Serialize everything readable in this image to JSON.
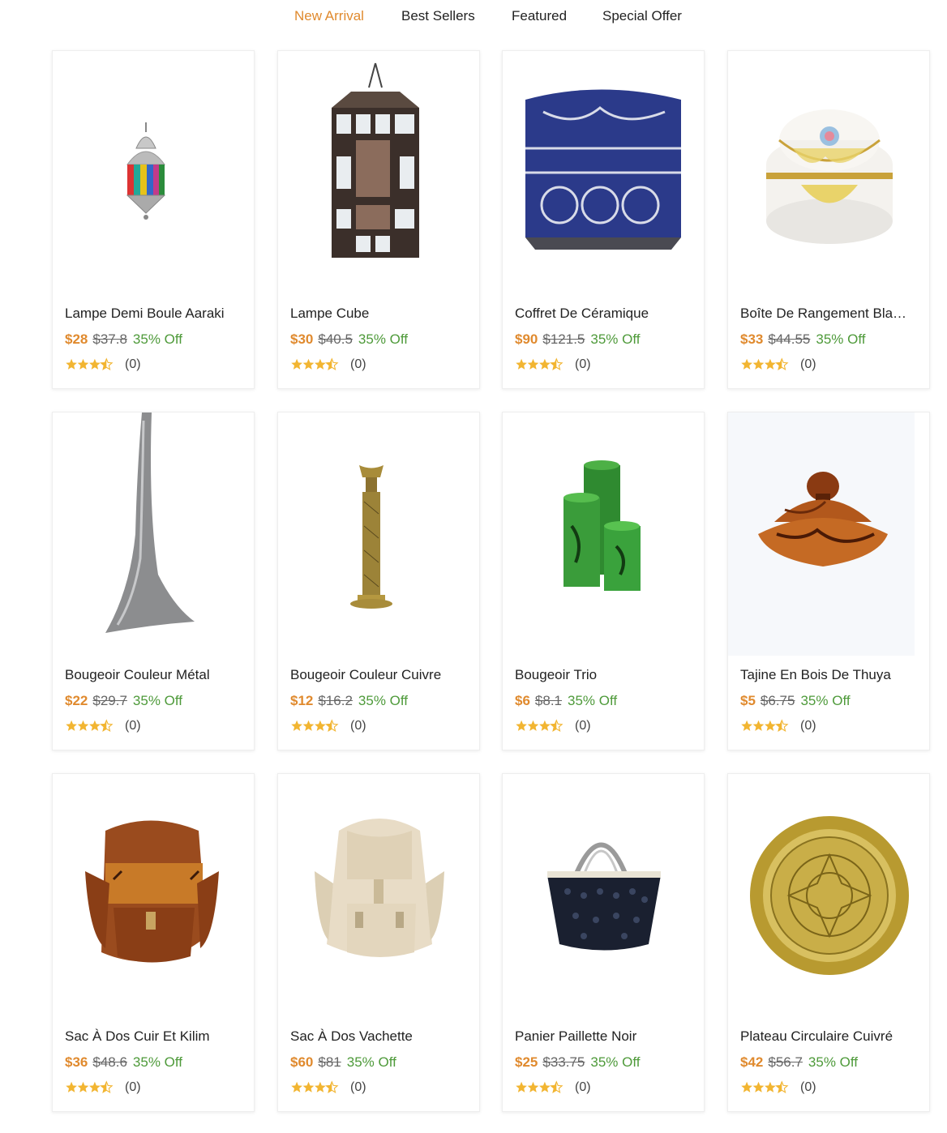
{
  "tabs": [
    {
      "label": "New Arrival",
      "active": true
    },
    {
      "label": "Best Sellers",
      "active": false
    },
    {
      "label": "Featured",
      "active": false
    },
    {
      "label": "Special Offer",
      "active": false
    }
  ],
  "colors": {
    "accent": "#e08a2e",
    "discount": "#4e9a3a",
    "star": "#f2b531"
  },
  "products": [
    {
      "title": "Lampe Demi Boule Aaraki",
      "price": "$28",
      "old_price": "$37.8",
      "discount": "35% Off",
      "rating": 3.5,
      "reviews": "(0)",
      "image": "hanging-lantern-colored"
    },
    {
      "title": "Lampe Cube",
      "price": "$30",
      "old_price": "$40.5",
      "discount": "35% Off",
      "rating": 3.5,
      "reviews": "(0)",
      "image": "cube-lantern"
    },
    {
      "title": "Coffret De Céramique",
      "price": "$90",
      "old_price": "$121.5",
      "discount": "35% Off",
      "rating": 3.5,
      "reviews": "(0)",
      "image": "ceramic-chest"
    },
    {
      "title": "Boîte De Rangement Bla…",
      "price": "$33",
      "old_price": "$44.55",
      "discount": "35% Off",
      "rating": 3.5,
      "reviews": "(0)",
      "image": "ceramic-box"
    },
    {
      "title": "Bougeoir Couleur Métal",
      "price": "$22",
      "old_price": "$29.7",
      "discount": "35% Off",
      "rating": 3.5,
      "reviews": "(0)",
      "image": "metal-candle-holder"
    },
    {
      "title": "Bougeoir Couleur Cuivre",
      "price": "$12",
      "old_price": "$16.2",
      "discount": "35% Off",
      "rating": 3.5,
      "reviews": "(0)",
      "image": "brass-candlestick"
    },
    {
      "title": "Bougeoir Trio",
      "price": "$6",
      "old_price": "$8.1",
      "discount": "35% Off",
      "rating": 3.5,
      "reviews": "(0)",
      "image": "green-trio-vases"
    },
    {
      "title": "Tajine En Bois De Thuya",
      "price": "$5",
      "old_price": "$6.75",
      "discount": "35% Off",
      "rating": 3.5,
      "reviews": "(0)",
      "image": "thuya-wood-tajine"
    },
    {
      "title": "Sac À Dos Cuir Et Kilim",
      "price": "$36",
      "old_price": "$48.6",
      "discount": "35% Off",
      "rating": 3.5,
      "reviews": "(0)",
      "image": "leather-kilim-backpack"
    },
    {
      "title": "Sac À Dos Vachette",
      "price": "$60",
      "old_price": "$81",
      "discount": "35% Off",
      "rating": 3.5,
      "reviews": "(0)",
      "image": "cream-leather-backpack"
    },
    {
      "title": "Panier Paillette Noir",
      "price": "$25",
      "old_price": "$33.75",
      "discount": "35% Off",
      "rating": 3.5,
      "reviews": "(0)",
      "image": "black-sequin-basket"
    },
    {
      "title": "Plateau Circulaire Cuivré",
      "price": "$42",
      "old_price": "$56.7",
      "discount": "35% Off",
      "rating": 3.5,
      "reviews": "(0)",
      "image": "brass-round-tray"
    }
  ]
}
